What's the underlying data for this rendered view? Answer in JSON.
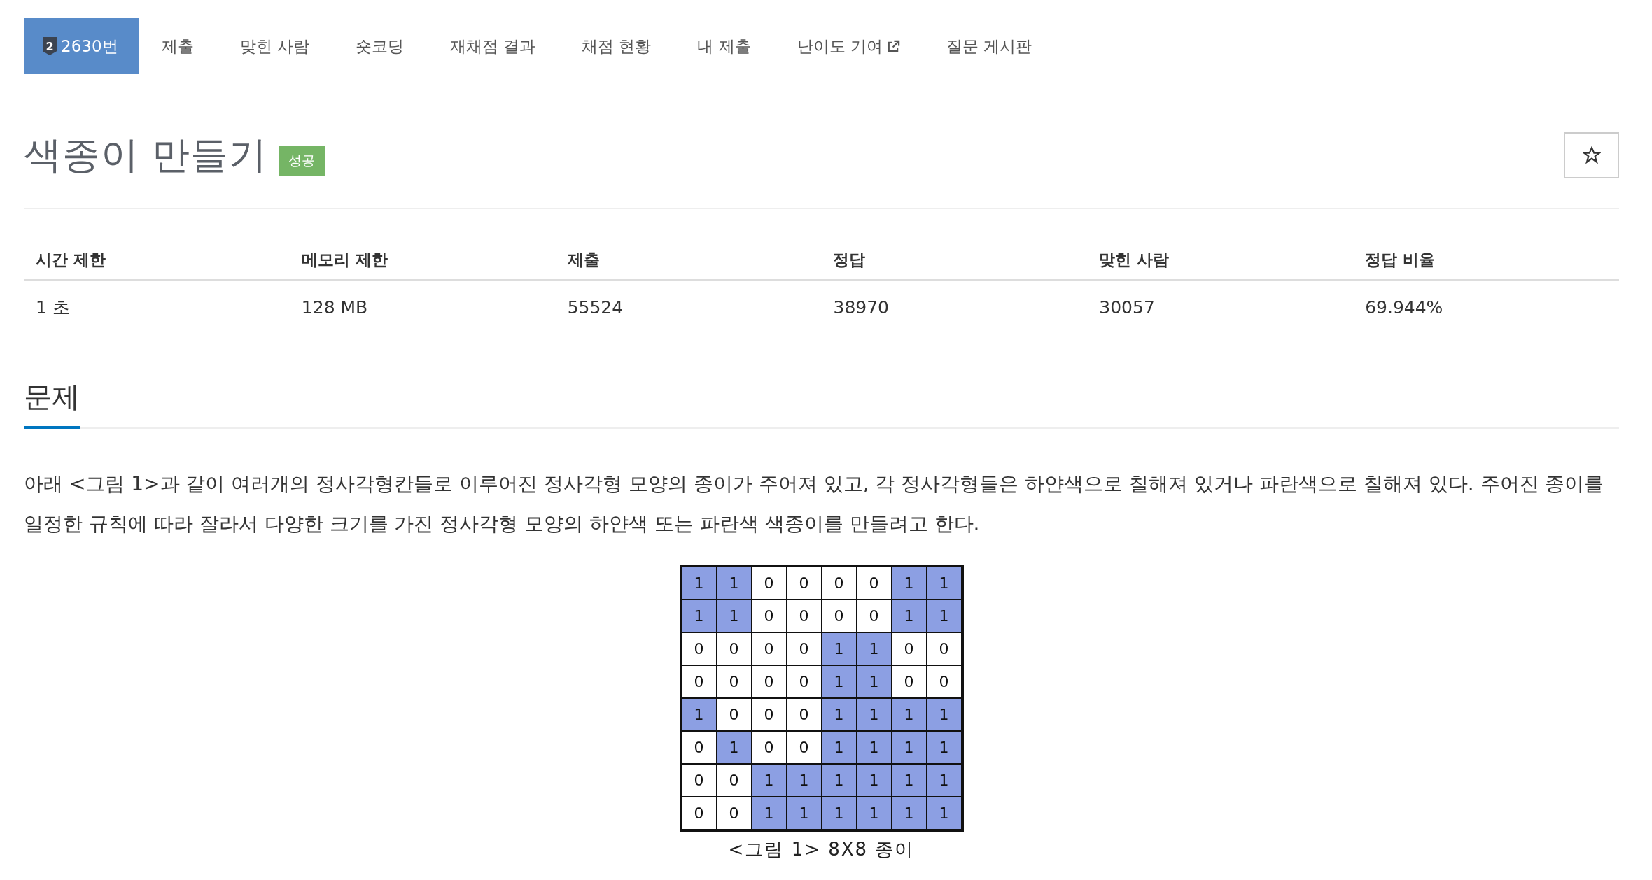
{
  "tabs": [
    {
      "label": "2630번",
      "tier": "2",
      "selected": true
    },
    {
      "label": "제출",
      "selected": false
    },
    {
      "label": "맞힌 사람",
      "selected": false
    },
    {
      "label": "숏코딩",
      "selected": false
    },
    {
      "label": "재채점 결과",
      "selected": false
    },
    {
      "label": "채점 현황",
      "selected": false
    },
    {
      "label": "내 제출",
      "selected": false
    },
    {
      "label": "난이도 기여",
      "external": true,
      "selected": false
    },
    {
      "label": "질문 게시판",
      "selected": false
    }
  ],
  "problem": {
    "title": "색종이 만들기",
    "badge": "성공",
    "starred": false
  },
  "info_table": {
    "columns": [
      "시간 제한",
      "메모리 제한",
      "제출",
      "정답",
      "맞힌 사람",
      "정답 비율"
    ],
    "rows": [
      [
        "1 초",
        "128 MB",
        "55524",
        "38970",
        "30057",
        "69.944%"
      ]
    ]
  },
  "section": {
    "heading": "문제",
    "paragraph": "아래 <그림 1>과 같이 여러개의 정사각형칸들로 이루어진 정사각형 모양의 종이가 주어져 있고, 각 정사각형들은 하얀색으로 칠해져 있거나 파란색으로 칠해져 있다. 주어진 종이를 일정한 규칙에 따라 잘라서 다양한 크기를 가진 정사각형 모양의 하얀색 또는 파란색 색종이를 만들려고 한다.",
    "figure": {
      "caption": "<그림 1> 8X8 종이",
      "grid": [
        [
          {
            "text": "1",
            "blue": true
          },
          {
            "text": "1",
            "blue": true
          },
          {
            "text": "0",
            "blue": false
          },
          {
            "text": "0",
            "blue": false
          },
          {
            "text": "0",
            "blue": false
          },
          {
            "text": "0",
            "blue": false
          },
          {
            "text": "1",
            "blue": true
          },
          {
            "text": "1",
            "blue": true
          }
        ],
        [
          {
            "text": "1",
            "blue": true
          },
          {
            "text": "1",
            "blue": true
          },
          {
            "text": "0",
            "blue": false
          },
          {
            "text": "0",
            "blue": false
          },
          {
            "text": "0",
            "blue": false
          },
          {
            "text": "0",
            "blue": false
          },
          {
            "text": "1",
            "blue": true
          },
          {
            "text": "1",
            "blue": true
          }
        ],
        [
          {
            "text": "0",
            "blue": false
          },
          {
            "text": "0",
            "blue": false
          },
          {
            "text": "0",
            "blue": false
          },
          {
            "text": "0",
            "blue": false
          },
          {
            "text": "1",
            "blue": true
          },
          {
            "text": "1",
            "blue": true
          },
          {
            "text": "0",
            "blue": false
          },
          {
            "text": "0",
            "blue": false
          }
        ],
        [
          {
            "text": "0",
            "blue": false
          },
          {
            "text": "0",
            "blue": false
          },
          {
            "text": "0",
            "blue": false
          },
          {
            "text": "0",
            "blue": false
          },
          {
            "text": "1",
            "blue": true
          },
          {
            "text": "1",
            "blue": true
          },
          {
            "text": "0",
            "blue": false
          },
          {
            "text": "0",
            "blue": false
          }
        ],
        [
          {
            "text": "1",
            "blue": true
          },
          {
            "text": "0",
            "blue": false
          },
          {
            "text": "0",
            "blue": false
          },
          {
            "text": "0",
            "blue": false
          },
          {
            "text": "1",
            "blue": true
          },
          {
            "text": "1",
            "blue": true
          },
          {
            "text": "1",
            "blue": true
          },
          {
            "text": "1",
            "blue": true
          }
        ],
        [
          {
            "text": "0",
            "blue": false
          },
          {
            "text": "1",
            "blue": true
          },
          {
            "text": "0",
            "blue": false
          },
          {
            "text": "0",
            "blue": false
          },
          {
            "text": "1",
            "blue": true
          },
          {
            "text": "1",
            "blue": true
          },
          {
            "text": "1",
            "blue": true
          },
          {
            "text": "1",
            "blue": true
          }
        ],
        [
          {
            "text": "0",
            "blue": false
          },
          {
            "text": "0",
            "blue": false
          },
          {
            "text": "1",
            "blue": true
          },
          {
            "text": "1",
            "blue": true
          },
          {
            "text": "1",
            "blue": true
          },
          {
            "text": "1",
            "blue": true
          },
          {
            "text": "1",
            "blue": true
          },
          {
            "text": "1",
            "blue": true
          }
        ],
        [
          {
            "text": "0",
            "blue": false
          },
          {
            "text": "0",
            "blue": false
          },
          {
            "text": "1",
            "blue": true
          },
          {
            "text": "1",
            "blue": true
          },
          {
            "text": "1",
            "blue": true
          },
          {
            "text": "1",
            "blue": true
          },
          {
            "text": "1",
            "blue": true
          },
          {
            "text": "1",
            "blue": true
          }
        ]
      ]
    }
  }
}
